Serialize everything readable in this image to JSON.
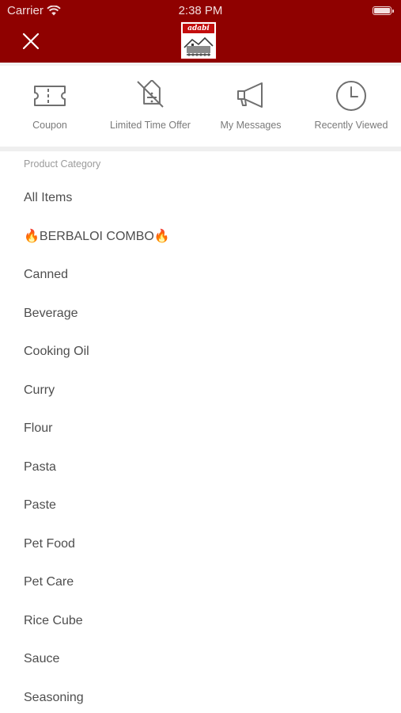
{
  "status_bar": {
    "carrier": "Carrier",
    "time": "2:38 PM"
  },
  "header": {
    "background_color": "#8f0100",
    "logo_text": "adabi"
  },
  "quick_links": [
    {
      "label": "Coupon",
      "icon": "coupon-ticket-icon"
    },
    {
      "label": "Limited Time Offer",
      "icon": "discount-tag-icon"
    },
    {
      "label": "My Messages",
      "icon": "megaphone-icon"
    },
    {
      "label": "Recently Viewed",
      "icon": "clock-icon"
    }
  ],
  "category_section": {
    "title": "Product Category",
    "items": [
      {
        "label": "All Items"
      },
      {
        "label": "🔥BERBALOI COMBO🔥"
      },
      {
        "label": "Canned"
      },
      {
        "label": "Beverage"
      },
      {
        "label": "Cooking Oil"
      },
      {
        "label": "Curry"
      },
      {
        "label": "Flour"
      },
      {
        "label": "Pasta"
      },
      {
        "label": "Paste"
      },
      {
        "label": "Pet Food"
      },
      {
        "label": "Pet Care"
      },
      {
        "label": "Rice Cube"
      },
      {
        "label": "Sauce"
      },
      {
        "label": "Seasoning"
      }
    ]
  }
}
